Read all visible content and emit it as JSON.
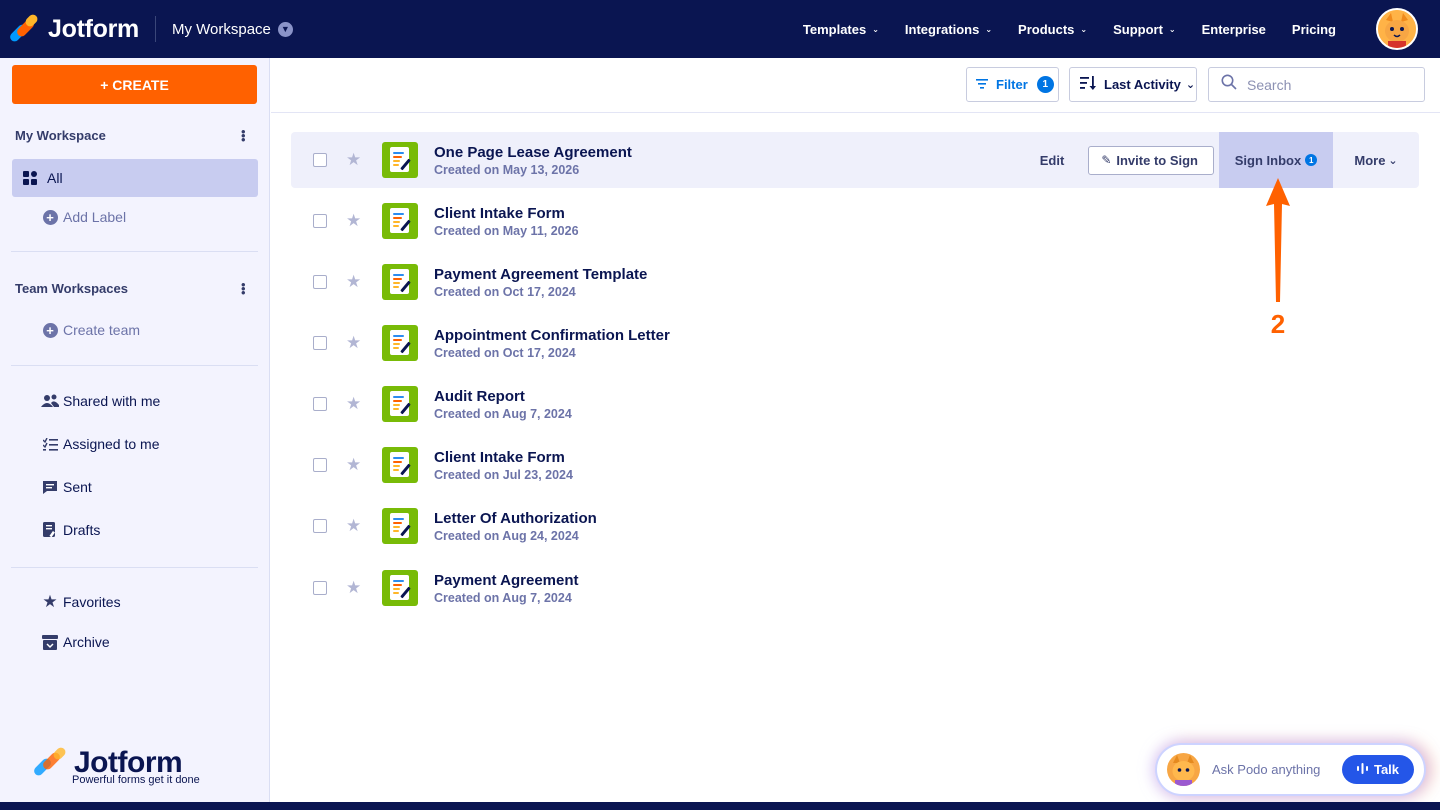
{
  "header": {
    "brand": "Jotform",
    "workspace_label": "My Workspace",
    "nav": [
      "Templates",
      "Integrations",
      "Products",
      "Support",
      "Enterprise",
      "Pricing"
    ],
    "nav_has_chevron": [
      true,
      true,
      true,
      true,
      false,
      false
    ]
  },
  "sidebar": {
    "create_label": "+ CREATE",
    "my_workspace_title": "My Workspace",
    "all_label": "All",
    "add_label": "Add Label",
    "team_title": "Team Workspaces",
    "create_team": "Create team",
    "shared": "Shared with me",
    "assigned": "Assigned to me",
    "sent": "Sent",
    "drafts": "Drafts",
    "favorites": "Favorites",
    "archive": "Archive",
    "footer_brand": "Jotform",
    "footer_tagline": "Powerful forms get it done"
  },
  "toolbar": {
    "filter_label": "Filter",
    "filter_count": "1",
    "sort_label": "Last Activity",
    "search_placeholder": "Search"
  },
  "forms": [
    {
      "title": "One Page Lease Agreement",
      "date": "Created on May 13, 2026"
    },
    {
      "title": "Client Intake Form",
      "date": "Created on May 11, 2026"
    },
    {
      "title": "Payment Agreement Template",
      "date": "Created on Oct 17, 2024"
    },
    {
      "title": "Appointment Confirmation Letter",
      "date": "Created on Oct 17, 2024"
    },
    {
      "title": "Audit Report",
      "date": "Created on Aug 7, 2024"
    },
    {
      "title": "Client Intake Form",
      "date": "Created on Jul 23, 2024"
    },
    {
      "title": "Letter Of Authorization",
      "date": "Created on Aug 24, 2024"
    },
    {
      "title": "Payment Agreement",
      "date": "Created on Aug 7, 2024"
    }
  ],
  "row_actions": {
    "edit": "Edit",
    "invite": "Invite to Sign",
    "inbox": "Sign Inbox",
    "inbox_count": "1",
    "more": "More"
  },
  "annotation": {
    "step_number": "2",
    "color": "#ff6100"
  },
  "assistant": {
    "prompt": "Ask Podo anything",
    "talk_label": "Talk"
  },
  "colors": {
    "navy": "#0a1551",
    "orange": "#ff6100",
    "blue": "#0075e3",
    "form_icon_green": "#78bb07"
  }
}
